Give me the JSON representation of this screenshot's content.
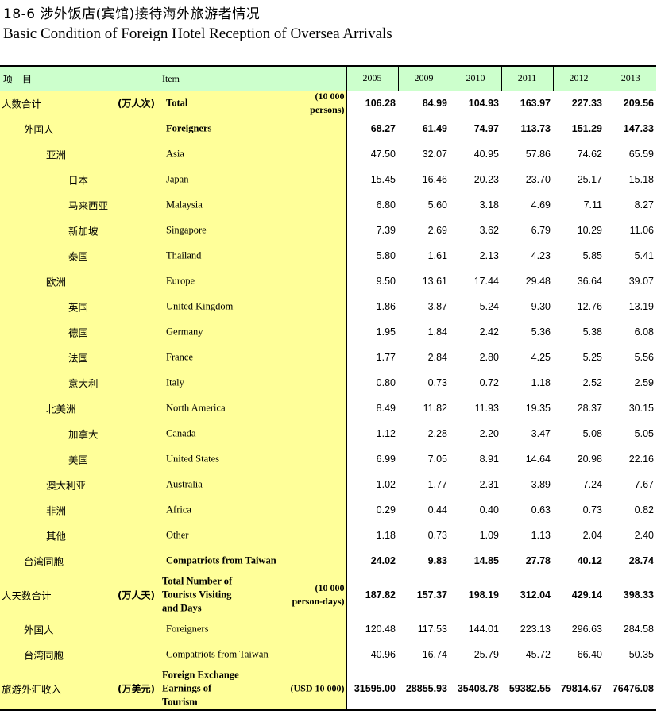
{
  "title_cn": "18-6  涉外饭店(宾馆)接待海外旅游者情况",
  "title_en": "Basic Condition of Foreign Hotel Reception of Oversea Arrivals",
  "header": {
    "item_cn": "项　目",
    "item_en": "Item",
    "years": [
      "2005",
      "2009",
      "2010",
      "2011",
      "2012",
      "2013"
    ]
  },
  "rows": [
    {
      "cn": "人数合计",
      "unit_cn": "(万人次)",
      "en": "Total",
      "unit_en": "(10 000\npersons)",
      "level": 0,
      "bold": true,
      "values": [
        "106.28",
        "84.99",
        "104.93",
        "163.97",
        "227.33",
        "209.56"
      ]
    },
    {
      "cn": "外国人",
      "en": "Foreigners",
      "level": 1,
      "bold": true,
      "values": [
        "68.27",
        "61.49",
        "74.97",
        "113.73",
        "151.29",
        "147.33"
      ]
    },
    {
      "cn": "亚洲",
      "en": "Asia",
      "level": 2,
      "values": [
        "47.50",
        "32.07",
        "40.95",
        "57.86",
        "74.62",
        "65.59"
      ]
    },
    {
      "cn": "日本",
      "en": "Japan",
      "level": 3,
      "values": [
        "15.45",
        "16.46",
        "20.23",
        "23.70",
        "25.17",
        "15.18"
      ]
    },
    {
      "cn": "马来西亚",
      "en": "Malaysia",
      "level": 3,
      "values": [
        "6.80",
        "5.60",
        "3.18",
        "4.69",
        "7.11",
        "8.27"
      ]
    },
    {
      "cn": "新加坡",
      "en": "Singapore",
      "level": 3,
      "values": [
        "7.39",
        "2.69",
        "3.62",
        "6.79",
        "10.29",
        "11.06"
      ]
    },
    {
      "cn": "泰国",
      "en": "Thailand",
      "level": 3,
      "values": [
        "5.80",
        "1.61",
        "2.13",
        "4.23",
        "5.85",
        "5.41"
      ]
    },
    {
      "cn": "欧洲",
      "en": "Europe",
      "level": 2,
      "values": [
        "9.50",
        "13.61",
        "17.44",
        "29.48",
        "36.64",
        "39.07"
      ]
    },
    {
      "cn": "英国",
      "en": "United Kingdom",
      "level": 3,
      "values": [
        "1.86",
        "3.87",
        "5.24",
        "9.30",
        "12.76",
        "13.19"
      ]
    },
    {
      "cn": "德国",
      "en": "Germany",
      "level": 3,
      "values": [
        "1.95",
        "1.84",
        "2.42",
        "5.36",
        "5.38",
        "6.08"
      ]
    },
    {
      "cn": "法国",
      "en": "France",
      "level": 3,
      "values": [
        "1.77",
        "2.84",
        "2.80",
        "4.25",
        "5.25",
        "5.56"
      ]
    },
    {
      "cn": "意大利",
      "en": "Italy",
      "level": 3,
      "values": [
        "0.80",
        "0.73",
        "0.72",
        "1.18",
        "2.52",
        "2.59"
      ]
    },
    {
      "cn": "北美洲",
      "en": "North America",
      "level": 2,
      "values": [
        "8.49",
        "11.82",
        "11.93",
        "19.35",
        "28.37",
        "30.15"
      ]
    },
    {
      "cn": "加拿大",
      "en": "Canada",
      "level": 3,
      "values": [
        "1.12",
        "2.28",
        "2.20",
        "3.47",
        "5.08",
        "5.05"
      ]
    },
    {
      "cn": "美国",
      "en": "United States",
      "level": 3,
      "values": [
        "6.99",
        "7.05",
        "8.91",
        "14.64",
        "20.98",
        "22.16"
      ]
    },
    {
      "cn": "澳大利亚",
      "en": "Australia",
      "level": 2,
      "values": [
        "1.02",
        "1.77",
        "2.31",
        "3.89",
        "7.24",
        "7.67"
      ]
    },
    {
      "cn": "非洲",
      "en": "Africa",
      "level": 2,
      "values": [
        "0.29",
        "0.44",
        "0.40",
        "0.63",
        "0.73",
        "0.82"
      ]
    },
    {
      "cn": "其他",
      "en": "Other",
      "level": 2,
      "values": [
        "1.18",
        "0.73",
        "1.09",
        "1.13",
        "2.04",
        "2.40"
      ]
    },
    {
      "cn": "台湾同胞",
      "en": "Compatriots from Taiwan",
      "level": 1,
      "bold": true,
      "values": [
        "24.02",
        "9.83",
        "14.85",
        "27.78",
        "40.12",
        "28.74"
      ]
    },
    {
      "cn": "人天数合计",
      "unit_cn": "(万人天)",
      "en": "Total Number of\nTourists Visiting\nand Days",
      "unit_en": "(10 000\nperson-days)",
      "level": 0,
      "bold": true,
      "size": "xtall",
      "values": [
        "187.82",
        "157.37",
        "198.19",
        "312.04",
        "429.14",
        "398.33"
      ]
    },
    {
      "cn": "外国人",
      "en": "Foreigners",
      "level": 1,
      "values": [
        "120.48",
        "117.53",
        "144.01",
        "223.13",
        "296.63",
        "284.58"
      ]
    },
    {
      "cn": "台湾同胞",
      "en": "Compatriots from Taiwan",
      "level": 1,
      "values": [
        "40.96",
        "16.74",
        "25.79",
        "45.72",
        "66.40",
        "50.35"
      ]
    },
    {
      "cn": "旅游外汇收入",
      "unit_cn": "(万美元)",
      "en": "Foreign Exchange\nEarnings of\nTourism",
      "unit_en": "(USD 10 000)",
      "level": 0,
      "bold": true,
      "size": "xtall",
      "last": true,
      "values": [
        "31595.00",
        "28855.93",
        "35408.78",
        "59382.55",
        "79814.67",
        "76476.08"
      ]
    }
  ]
}
